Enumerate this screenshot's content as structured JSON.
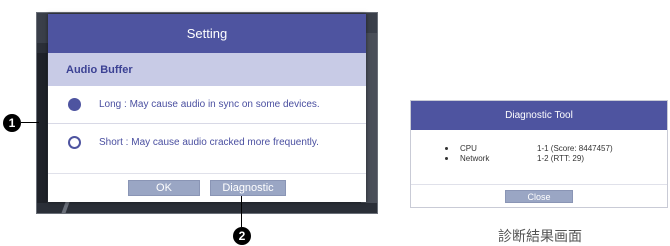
{
  "setting_dialog": {
    "title": "Setting",
    "section_title": "Audio Buffer",
    "options": [
      {
        "label": "Long : May cause audio in sync on some devices.",
        "selected": true
      },
      {
        "label": "Short : May cause audio cracked more frequently.",
        "selected": false
      }
    ],
    "buttons": {
      "ok": "OK",
      "diagnostic": "Diagnostic"
    }
  },
  "callouts": {
    "one": "1",
    "two": "2"
  },
  "diagnostic_tool": {
    "title": "Diagnostic Tool",
    "rows": [
      {
        "label": "CPU",
        "value": "1-1 (Score: 8447457)"
      },
      {
        "label": "Network",
        "value": "1-2 (RTT: 29)"
      }
    ],
    "close_label": "Close"
  },
  "caption": "診断結果画面",
  "colors": {
    "accent": "#4e54a0",
    "section_bg": "#c8cbe6",
    "button_bg": "#9aa6c4"
  }
}
